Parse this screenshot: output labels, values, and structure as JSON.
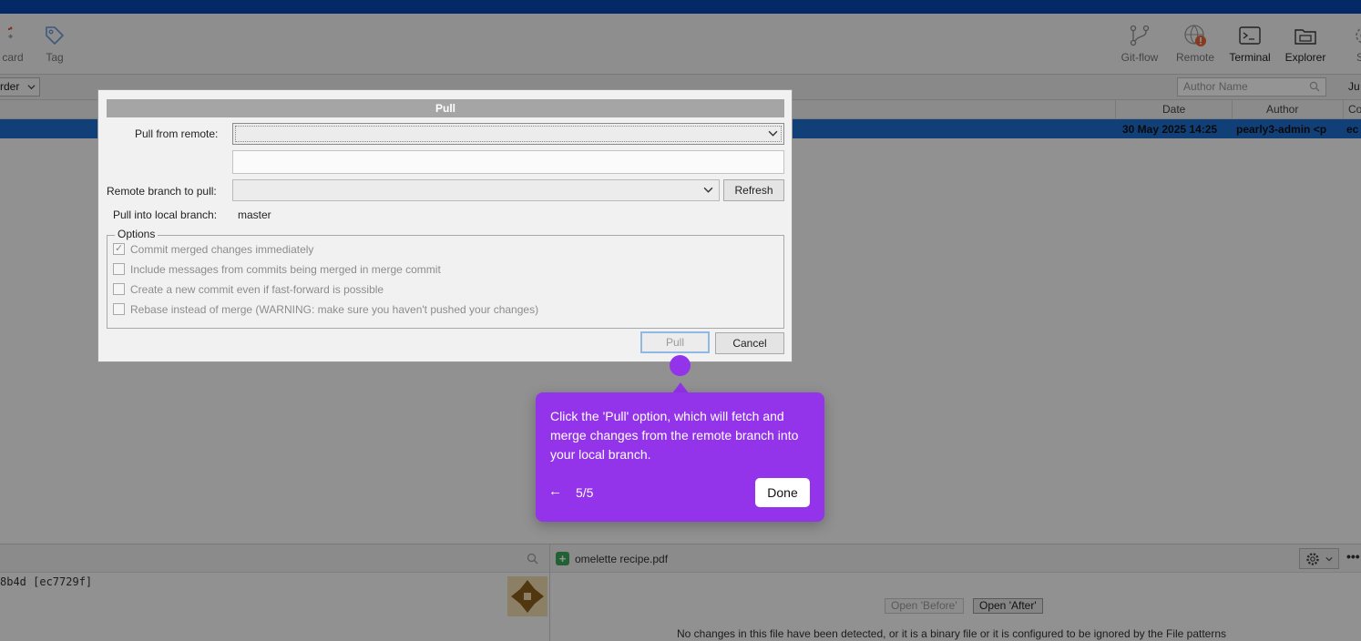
{
  "colors": {
    "titlebar": "#0a47b0",
    "selected_row": "#1e6fd1",
    "tooltip": "#9333ea",
    "file_added": "#3aa85a"
  },
  "toolbar": {
    "left_items": [
      {
        "label": "card",
        "icon": "discard-icon"
      },
      {
        "label": "Tag",
        "icon": "tag-icon"
      }
    ],
    "right_items": [
      {
        "label": "Git-flow",
        "icon": "git-flow-icon"
      },
      {
        "label": "Remote",
        "icon": "remote-icon"
      },
      {
        "label": "Terminal",
        "icon": "terminal-icon"
      },
      {
        "label": "Explorer",
        "icon": "explorer-icon"
      },
      {
        "label": "Setti",
        "icon": "settings-icon"
      }
    ]
  },
  "filter": {
    "order_label": "rder",
    "author_placeholder": "Author Name",
    "ju_label": "Ju"
  },
  "columns": {
    "date": "Date",
    "author": "Author",
    "commit": "Co"
  },
  "commit_row": {
    "date": "30 May 2025 14:25",
    "author": "pearly3-admin <p",
    "commit": "ec"
  },
  "details": {
    "hash": "8b4d [ec7729f]",
    "file_name": "omelette recipe.pdf",
    "open_before": "Open 'Before'",
    "open_after": "Open 'After'",
    "no_changes": "No changes in this file have been detected, or it is a binary file or it is configured to be ignored by the File patterns"
  },
  "dialog": {
    "title": "Pull",
    "pull_from_remote_label": "Pull from remote:",
    "pull_from_remote_value": "",
    "remote_url_value": "",
    "remote_branch_label": "Remote branch to pull:",
    "remote_branch_value": "",
    "refresh_label": "Refresh",
    "local_branch_label": "Pull into local branch:",
    "local_branch_value": "master",
    "options_label": "Options",
    "options": [
      {
        "label": "Commit merged changes immediately",
        "checked": true
      },
      {
        "label": "Include messages from commits being merged in merge commit",
        "checked": false
      },
      {
        "label": "Create a new commit even if fast-forward is possible",
        "checked": false
      },
      {
        "label": "Rebase instead of merge (WARNING: make sure you haven't pushed your changes)",
        "checked": false
      }
    ],
    "pull_button": "Pull",
    "cancel_button": "Cancel"
  },
  "tooltip": {
    "text": "Click the 'Pull' option, which will fetch and merge changes from the remote branch into your local branch.",
    "back_icon": "←",
    "step": "5/5",
    "done_label": "Done"
  }
}
